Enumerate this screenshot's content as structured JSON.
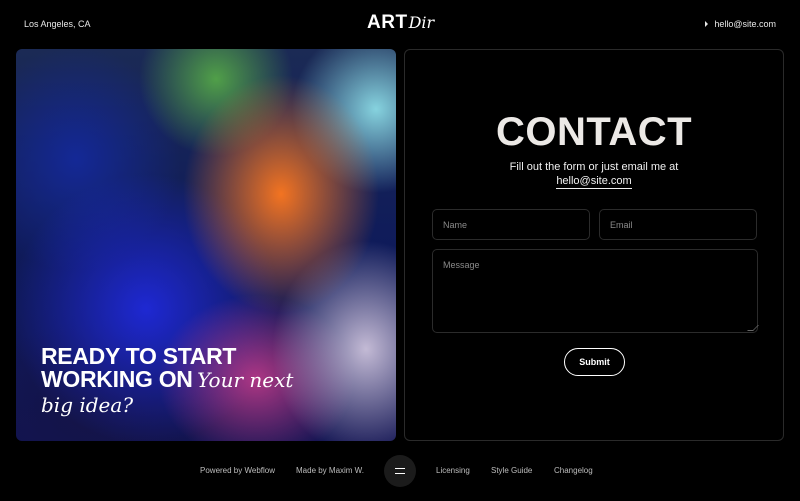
{
  "header": {
    "location": "Los Angeles, CA",
    "logo_bold": "ART",
    "logo_italic": "Dir",
    "email": "hello@site.com"
  },
  "hero": {
    "line1": "READY TO START",
    "line2_bold": "WORKING ON",
    "line2_italic": "Your next",
    "line3_italic": "big idea?"
  },
  "contact": {
    "title": "CONTACT",
    "subtitle": "Fill out the form or just email me at",
    "email": "hello@site.com",
    "form": {
      "name_placeholder": "Name",
      "email_placeholder": "Email",
      "message_placeholder": "Message",
      "submit_label": "Submit"
    }
  },
  "footer": {
    "powered_by": "Powered by Webflow",
    "made_by": "Made by Maxim W.",
    "licensing": "Licensing",
    "style_guide": "Style Guide",
    "changelog": "Changelog",
    "menu_icon": "menu-icon"
  }
}
